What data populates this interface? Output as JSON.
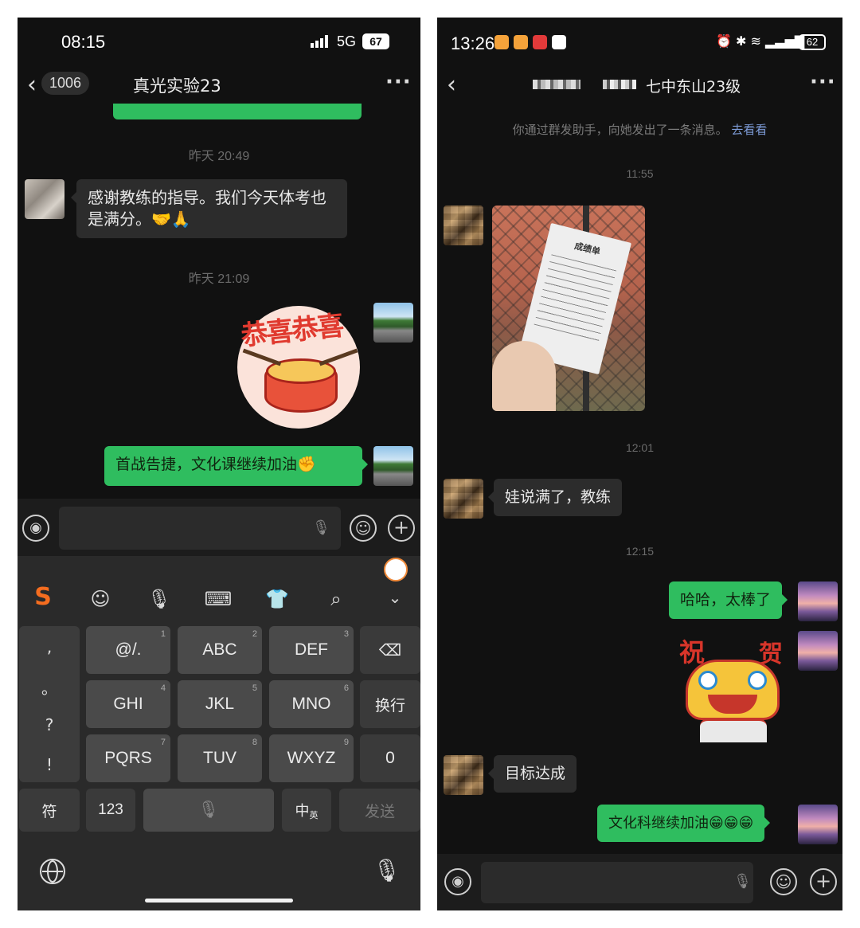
{
  "left": {
    "status": {
      "time": "08:15",
      "network": "5G",
      "battery": "67"
    },
    "header": {
      "back_count": "1006",
      "title": "真光实验23"
    },
    "messages": {
      "ts1": "昨天 20:49",
      "msg1": "感谢教练的指导。我们今天体考也是满分。🤝🙏",
      "ts2": "昨天 21:09",
      "sticker_text": "恭喜恭喜",
      "msg2": "首战告捷，文化课继续加油✊"
    },
    "keyboard": {
      "row1": [
        {
          "label": "@/.",
          "num": "1"
        },
        {
          "label": "ABC",
          "num": "2"
        },
        {
          "label": "DEF",
          "num": "3"
        }
      ],
      "row2": [
        {
          "label": "GHI",
          "num": "4"
        },
        {
          "label": "JKL",
          "num": "5"
        },
        {
          "label": "MNO",
          "num": "6"
        }
      ],
      "row3": [
        {
          "label": "PQRS",
          "num": "7"
        },
        {
          "label": "TUV",
          "num": "8"
        },
        {
          "label": "WXYZ",
          "num": "9"
        }
      ],
      "newline": "换行",
      "zero": "0",
      "symbols": "符",
      "numbers": "123",
      "lang_cn": "中",
      "lang_en": "英",
      "send": "发送",
      "punct": [
        ",",
        "。",
        "?",
        "!"
      ]
    }
  },
  "right": {
    "status": {
      "time": "13:26",
      "battery": "62"
    },
    "header": {
      "title": "七中东山23级"
    },
    "system_notice": {
      "text": "你通过群发助手，向她发出了一条消息。",
      "link": "去看看"
    },
    "messages": {
      "ts1": "11:55",
      "receipt_title": "成绩单",
      "ts2": "12:01",
      "msg1": "娃说满了，教练",
      "ts3": "12:15",
      "msg2": "哈哈，太棒了",
      "sticker_left": "祝",
      "sticker_right": "贺",
      "msg3": "目标达成",
      "msg4": "文化科继续加油😁😁😁"
    }
  },
  "colors": {
    "green_bubble": "#2fbd5f",
    "dark_bg": "#111111",
    "link": "#7d9bd6"
  }
}
